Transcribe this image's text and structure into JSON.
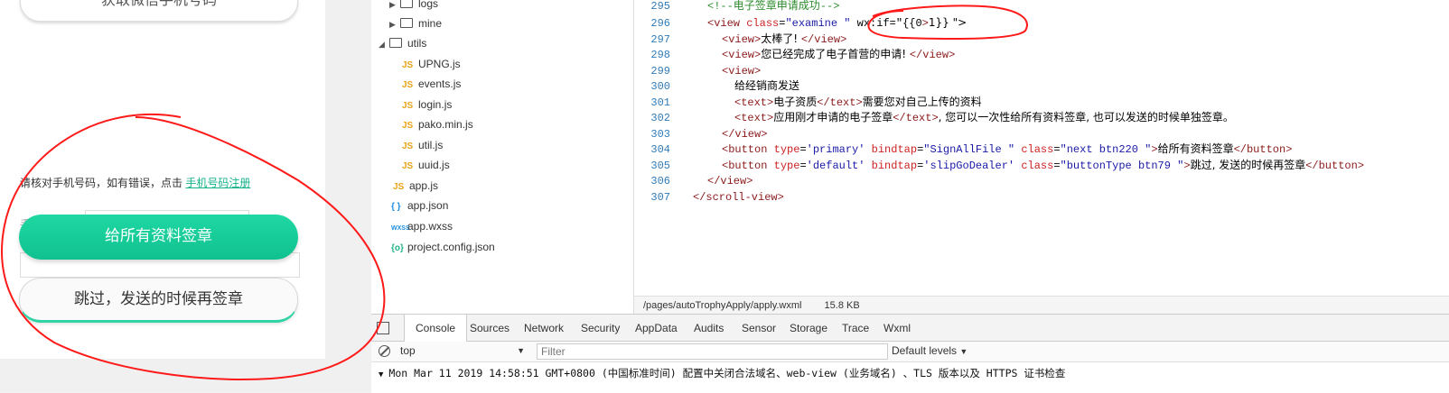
{
  "simulator": {
    "top_button_label": "获取微信手机号码",
    "verify_text": "请核对手机号码，如有错误，点击",
    "verify_link": "手机号码注册",
    "hidden_label": "手",
    "primary_button": "给所有资料签章",
    "default_button": "跳过，发送的时候再签章"
  },
  "file_tree": {
    "items": [
      {
        "kind": "folder",
        "label": "logs"
      },
      {
        "kind": "folder",
        "label": "mine"
      },
      {
        "kind": "folder-open",
        "label": "utils"
      },
      {
        "kind": "js",
        "icon": "JS",
        "label": "UPNG.js"
      },
      {
        "kind": "js",
        "icon": "JS",
        "label": "events.js"
      },
      {
        "kind": "js",
        "icon": "JS",
        "label": "login.js"
      },
      {
        "kind": "js",
        "icon": "JS",
        "label": "pako.min.js"
      },
      {
        "kind": "js",
        "icon": "JS",
        "label": "util.js"
      },
      {
        "kind": "js",
        "icon": "JS",
        "label": "uuid.js"
      },
      {
        "kind": "js",
        "icon": "JS",
        "label": "app.js"
      },
      {
        "kind": "json",
        "icon": "{ }",
        "label": "app.json"
      },
      {
        "kind": "wxss",
        "icon": "WXSS",
        "label": "app.wxss"
      },
      {
        "kind": "cfg",
        "icon": "{o}",
        "label": "project.config.json"
      }
    ]
  },
  "editor": {
    "lines": [
      {
        "n": "295",
        "code": "<!--电子签章申请成功-->"
      },
      {
        "n": "296",
        "code": "<view class=\"examine \" wx:if=\"{{0>1}} \">"
      },
      {
        "n": "297",
        "code": "<view>太棒了! </view>"
      },
      {
        "n": "298",
        "code": "<view>您已经完成了电子首营的申请! </view>"
      },
      {
        "n": "299",
        "code": "<view>"
      },
      {
        "n": "300",
        "code": "给经销商发送"
      },
      {
        "n": "301",
        "code": "<text>电子资质</text>需要您对自己上传的资料"
      },
      {
        "n": "302",
        "code": "<text>应用刚才申请的电子签章</text>, 您可以一次性给所有资料签章, 也可以发送的时候单独签章。"
      },
      {
        "n": "303",
        "code": "</view>"
      },
      {
        "n": "304",
        "code": "<button type='primary' bindtap=\"SignAllFile \" class=\"next btn220 \">给所有资料签章</button>"
      },
      {
        "n": "305",
        "code": "<button type='default' bindtap='slipGoDealer' class=\"buttonType btn79 \">跳过, 发送的时候再签章</button>"
      },
      {
        "n": "306",
        "code": "</view>"
      },
      {
        "n": "307",
        "code": "</scroll-view>"
      }
    ],
    "status_path": "/pages/autoTrophyApply/apply.wxml",
    "status_size": "15.8 KB"
  },
  "devtools": {
    "tabs": [
      "Console",
      "Sources",
      "Network",
      "Security",
      "AppData",
      "Audits",
      "Sensor",
      "Storage",
      "Trace",
      "Wxml"
    ],
    "active_tab": "Console",
    "context": "top",
    "filter_placeholder": "Filter",
    "levels": "Default levels",
    "log_line": "Mon Mar 11 2019 14:58:51 GMT+0800 (中国标准时间) 配置中关闭合法域名、web-view (业务域名) 、TLS 版本以及 HTTPS 证书检查"
  },
  "colors": {
    "primary_green": "#10c18f",
    "annotation_red": "#ff1a1a",
    "line_number": "#2f7bb8"
  }
}
